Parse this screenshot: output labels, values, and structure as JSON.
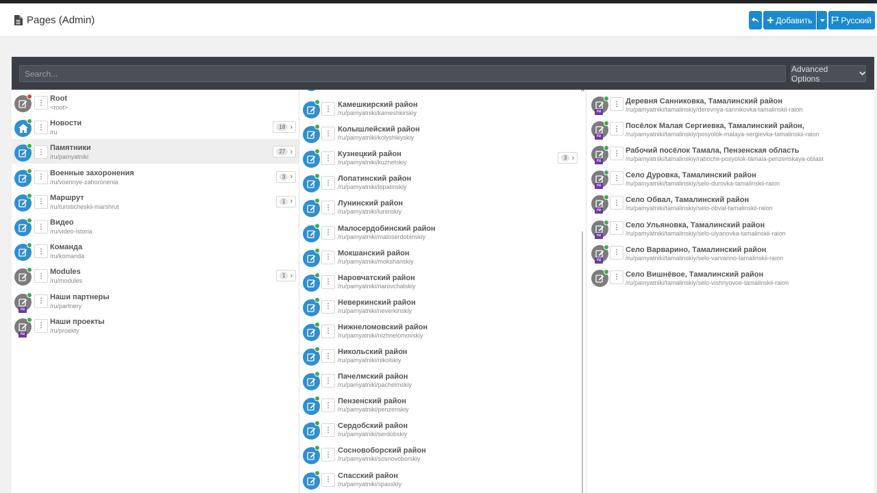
{
  "header": {
    "title": "Pages (Admin)",
    "add_label": "Добавить",
    "language_label": "Русский",
    "accent_color": "#1a8ad0"
  },
  "search": {
    "placeholder": "Search...",
    "advanced_label": "Advanced Options"
  },
  "column1": [
    {
      "title": "Root",
      "url": "<root>",
      "icon": "edit-icon",
      "avatar": "grey",
      "status": "red"
    },
    {
      "title": "Новости",
      "url": "/ru",
      "icon": "home-icon",
      "avatar": "blue",
      "status": "green",
      "count": "18"
    },
    {
      "title": "Памятники",
      "url": "/ru/pamyatniki",
      "icon": "edit-icon",
      "avatar": "blue",
      "status": "green",
      "count": "27",
      "selected": true
    },
    {
      "title": "Военные захоронения",
      "url": "/ru/voennye-zahoronenia",
      "icon": "edit-icon",
      "avatar": "blue",
      "status": "green",
      "count": "3"
    },
    {
      "title": "Маршрут",
      "url": "/ru/turisticheskii-marshrut",
      "icon": "edit-icon",
      "avatar": "blue",
      "status": "green",
      "count": "1"
    },
    {
      "title": "Видео",
      "url": "/ru/video-istoria",
      "icon": "edit-icon",
      "avatar": "blue",
      "status": "green"
    },
    {
      "title": "Команда",
      "url": "/ru/komanda",
      "icon": "edit-icon",
      "avatar": "blue",
      "status": "green"
    },
    {
      "title": "Modules",
      "url": "/ru/modules",
      "icon": "edit-icon",
      "avatar": "grey",
      "status": "green",
      "count": "1"
    },
    {
      "title": "Наши партнеры",
      "url": "/ru/partnery",
      "icon": "edit-icon",
      "avatar": "grey",
      "status": "green",
      "lang": "ru"
    },
    {
      "title": "Наши проекты",
      "url": "/ru/proekty",
      "icon": "edit-icon",
      "avatar": "grey",
      "status": "green",
      "lang": "ru"
    }
  ],
  "column2": [
    {
      "title": "Камешкирский район",
      "url": "/ru/pamyatniki/kameshkirskiy"
    },
    {
      "title": "Колышлейский район",
      "url": "/ru/pamyatniki/kolyshleyskiy"
    },
    {
      "title": "Кузнецкий район",
      "url": "/ru/pamyatniki/kuznetskiy",
      "count": "3"
    },
    {
      "title": "Лопатинский район",
      "url": "/ru/pamyatniki/lopatinskiy"
    },
    {
      "title": "Лунинский район",
      "url": "/ru/pamyatniki/luninskiy"
    },
    {
      "title": "Малосердобинский район",
      "url": "/ru/pamyatniki/maloserdobinskiy"
    },
    {
      "title": "Мокшанский район",
      "url": "/ru/pamyatniki/mokshanskiy"
    },
    {
      "title": "Наровчатский район",
      "url": "/ru/pamyatniki/narovchatskiy"
    },
    {
      "title": "Неверкинский район",
      "url": "/ru/pamyatniki/neverkinskiy"
    },
    {
      "title": "Нижнеломовский район",
      "url": "/ru/pamyatniki/nizhnelomovskiy"
    },
    {
      "title": "Никольский район",
      "url": "/ru/pamyatniki/nikolskiy"
    },
    {
      "title": "Пачелмский район",
      "url": "/ru/pamyatniki/pachelmskiy"
    },
    {
      "title": "Пензенский район",
      "url": "/ru/pamyatniki/penzenskiy"
    },
    {
      "title": "Сердобский район",
      "url": "/ru/pamyatniki/serdobskiy"
    },
    {
      "title": "Сосновоборский район",
      "url": "/ru/pamyatniki/sosnovoborskiy"
    },
    {
      "title": "Спасский район",
      "url": "/ru/pamyatniki/spasskiy"
    }
  ],
  "column3": [
    {
      "title": "Деревня Санниковка, Тамалинский район",
      "url": "/ru/pamyatniki/tamalinskiy/derevnya-sannikovka-tamalinskii-raion",
      "lang": "ru"
    },
    {
      "title": "Посёлок Малая Сергиевка, Тамалинский район,",
      "url": "/ru/pamyatniki/tamalinskiy/posyolok-malaya-sergievka-tamalinskii-raion",
      "lang": "ru"
    },
    {
      "title": "Рабочий посёлок Тамала, Пензенская область",
      "url": "/ru/pamyatniki/tamalinskiy/rabochii-posyolok-tamala-penzenskaya-oblast",
      "lang": "ru"
    },
    {
      "title": "Село Дуровка, Тамалинский район",
      "url": "/ru/pamyatniki/tamalinskiy/selo-durovka-tamalinskii-raion",
      "lang": "ru"
    },
    {
      "title": "Село Обвал, Тамалинский район",
      "url": "/ru/pamyatniki/tamalinskiy/selo-obval-tamalinskii-raion",
      "lang": "ru"
    },
    {
      "title": "Село Ульяновка, Тамалинский район",
      "url": "/ru/pamyatniki/tamalinskiy/selo-ulyanovka-tamalinskii-raion",
      "lang": "ru"
    },
    {
      "title": "Село Варварино, Тамалинский район",
      "url": "/ru/pamyatniki/tamalinskiy/selo-varvarino-tamalinskii-raion",
      "lang": "ru"
    },
    {
      "title": "Село Вишнёвое, Тамалинский район",
      "url": "/ru/pamyatniki/tamalinskiy/selo-vishnyovoe-tamalinskii-raion"
    }
  ]
}
